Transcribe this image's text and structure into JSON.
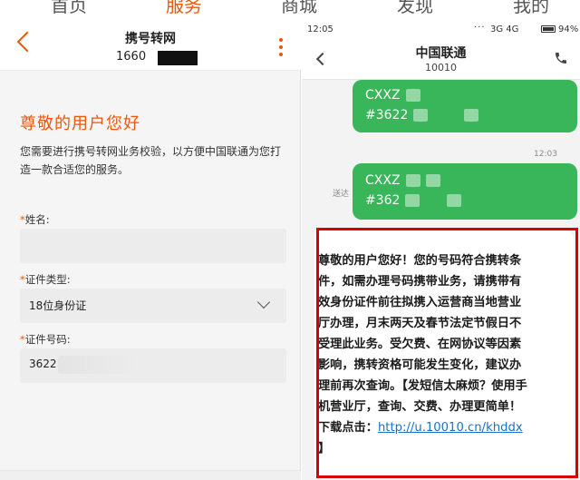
{
  "top_nav": {
    "items": [
      "首页",
      "服务",
      "商城",
      "发现",
      "我的"
    ],
    "active_index": 1
  },
  "left": {
    "title": "携号转网",
    "phone_prefix": "1660",
    "greeting": "尊敬的用户您好",
    "description": "您需要进行携号转网业务校验，以方便中国联通为您打造一款合适您的服务。",
    "fields": {
      "name": {
        "label": "姓名:",
        "value": ""
      },
      "id_type": {
        "label": "证件类型:",
        "value": "18位身份证"
      },
      "id_number": {
        "label": "证件号码:",
        "value": "3622"
      }
    }
  },
  "right": {
    "status_bar": {
      "time": "12:05",
      "network": "3G 4G",
      "battery": "94%"
    },
    "contact": {
      "name": "中国联通",
      "number": "10010"
    },
    "messages": {
      "out1_line1": "CXXZ",
      "out1_line2": "#3622",
      "timestamp": "12:03",
      "sent_label": "送达",
      "out2_line1": "CXXZ",
      "out2_line2": "#362"
    },
    "reply_text": "尊敬的用户您好！您的号码符合携转条件，如需办理号码携带业务，请携带有效身份证件前往拟携入运营商当地营业厅办理，月末两天及春节法定节假日不受理此业务。受欠费、在网协议等因素影响，携转资格可能发生变化，建议办理前再次查询。【发短信太麻烦？使用手机营业厅，查询、交费、办理更简单！下载点击：",
    "reply_link": "http://u.10010.cn/khddx",
    "reply_suffix": " 】"
  },
  "colors": {
    "accent": "#e8580c",
    "bubble_green": "#3ab65a",
    "highlight_red": "#d80000",
    "link_blue": "#1a73c8"
  }
}
